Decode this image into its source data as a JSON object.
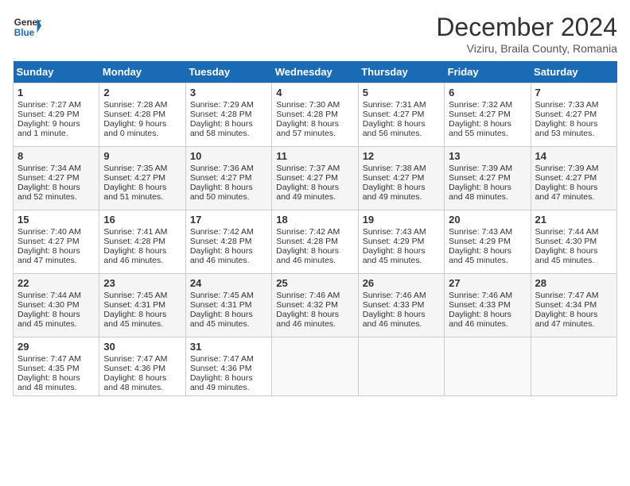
{
  "header": {
    "logo_line1": "General",
    "logo_line2": "Blue",
    "month": "December 2024",
    "location": "Viziru, Braila County, Romania"
  },
  "days_of_week": [
    "Sunday",
    "Monday",
    "Tuesday",
    "Wednesday",
    "Thursday",
    "Friday",
    "Saturday"
  ],
  "weeks": [
    [
      {
        "day": 1,
        "lines": [
          "Sunrise: 7:27 AM",
          "Sunset: 4:29 PM",
          "Daylight: 9 hours",
          "and 1 minute."
        ]
      },
      {
        "day": 2,
        "lines": [
          "Sunrise: 7:28 AM",
          "Sunset: 4:28 PM",
          "Daylight: 9 hours",
          "and 0 minutes."
        ]
      },
      {
        "day": 3,
        "lines": [
          "Sunrise: 7:29 AM",
          "Sunset: 4:28 PM",
          "Daylight: 8 hours",
          "and 58 minutes."
        ]
      },
      {
        "day": 4,
        "lines": [
          "Sunrise: 7:30 AM",
          "Sunset: 4:28 PM",
          "Daylight: 8 hours",
          "and 57 minutes."
        ]
      },
      {
        "day": 5,
        "lines": [
          "Sunrise: 7:31 AM",
          "Sunset: 4:27 PM",
          "Daylight: 8 hours",
          "and 56 minutes."
        ]
      },
      {
        "day": 6,
        "lines": [
          "Sunrise: 7:32 AM",
          "Sunset: 4:27 PM",
          "Daylight: 8 hours",
          "and 55 minutes."
        ]
      },
      {
        "day": 7,
        "lines": [
          "Sunrise: 7:33 AM",
          "Sunset: 4:27 PM",
          "Daylight: 8 hours",
          "and 53 minutes."
        ]
      }
    ],
    [
      {
        "day": 8,
        "lines": [
          "Sunrise: 7:34 AM",
          "Sunset: 4:27 PM",
          "Daylight: 8 hours",
          "and 52 minutes."
        ]
      },
      {
        "day": 9,
        "lines": [
          "Sunrise: 7:35 AM",
          "Sunset: 4:27 PM",
          "Daylight: 8 hours",
          "and 51 minutes."
        ]
      },
      {
        "day": 10,
        "lines": [
          "Sunrise: 7:36 AM",
          "Sunset: 4:27 PM",
          "Daylight: 8 hours",
          "and 50 minutes."
        ]
      },
      {
        "day": 11,
        "lines": [
          "Sunrise: 7:37 AM",
          "Sunset: 4:27 PM",
          "Daylight: 8 hours",
          "and 49 minutes."
        ]
      },
      {
        "day": 12,
        "lines": [
          "Sunrise: 7:38 AM",
          "Sunset: 4:27 PM",
          "Daylight: 8 hours",
          "and 49 minutes."
        ]
      },
      {
        "day": 13,
        "lines": [
          "Sunrise: 7:39 AM",
          "Sunset: 4:27 PM",
          "Daylight: 8 hours",
          "and 48 minutes."
        ]
      },
      {
        "day": 14,
        "lines": [
          "Sunrise: 7:39 AM",
          "Sunset: 4:27 PM",
          "Daylight: 8 hours",
          "and 47 minutes."
        ]
      }
    ],
    [
      {
        "day": 15,
        "lines": [
          "Sunrise: 7:40 AM",
          "Sunset: 4:27 PM",
          "Daylight: 8 hours",
          "and 47 minutes."
        ]
      },
      {
        "day": 16,
        "lines": [
          "Sunrise: 7:41 AM",
          "Sunset: 4:28 PM",
          "Daylight: 8 hours",
          "and 46 minutes."
        ]
      },
      {
        "day": 17,
        "lines": [
          "Sunrise: 7:42 AM",
          "Sunset: 4:28 PM",
          "Daylight: 8 hours",
          "and 46 minutes."
        ]
      },
      {
        "day": 18,
        "lines": [
          "Sunrise: 7:42 AM",
          "Sunset: 4:28 PM",
          "Daylight: 8 hours",
          "and 46 minutes."
        ]
      },
      {
        "day": 19,
        "lines": [
          "Sunrise: 7:43 AM",
          "Sunset: 4:29 PM",
          "Daylight: 8 hours",
          "and 45 minutes."
        ]
      },
      {
        "day": 20,
        "lines": [
          "Sunrise: 7:43 AM",
          "Sunset: 4:29 PM",
          "Daylight: 8 hours",
          "and 45 minutes."
        ]
      },
      {
        "day": 21,
        "lines": [
          "Sunrise: 7:44 AM",
          "Sunset: 4:30 PM",
          "Daylight: 8 hours",
          "and 45 minutes."
        ]
      }
    ],
    [
      {
        "day": 22,
        "lines": [
          "Sunrise: 7:44 AM",
          "Sunset: 4:30 PM",
          "Daylight: 8 hours",
          "and 45 minutes."
        ]
      },
      {
        "day": 23,
        "lines": [
          "Sunrise: 7:45 AM",
          "Sunset: 4:31 PM",
          "Daylight: 8 hours",
          "and 45 minutes."
        ]
      },
      {
        "day": 24,
        "lines": [
          "Sunrise: 7:45 AM",
          "Sunset: 4:31 PM",
          "Daylight: 8 hours",
          "and 45 minutes."
        ]
      },
      {
        "day": 25,
        "lines": [
          "Sunrise: 7:46 AM",
          "Sunset: 4:32 PM",
          "Daylight: 8 hours",
          "and 46 minutes."
        ]
      },
      {
        "day": 26,
        "lines": [
          "Sunrise: 7:46 AM",
          "Sunset: 4:33 PM",
          "Daylight: 8 hours",
          "and 46 minutes."
        ]
      },
      {
        "day": 27,
        "lines": [
          "Sunrise: 7:46 AM",
          "Sunset: 4:33 PM",
          "Daylight: 8 hours",
          "and 46 minutes."
        ]
      },
      {
        "day": 28,
        "lines": [
          "Sunrise: 7:47 AM",
          "Sunset: 4:34 PM",
          "Daylight: 8 hours",
          "and 47 minutes."
        ]
      }
    ],
    [
      {
        "day": 29,
        "lines": [
          "Sunrise: 7:47 AM",
          "Sunset: 4:35 PM",
          "Daylight: 8 hours",
          "and 48 minutes."
        ]
      },
      {
        "day": 30,
        "lines": [
          "Sunrise: 7:47 AM",
          "Sunset: 4:36 PM",
          "Daylight: 8 hours",
          "and 48 minutes."
        ]
      },
      {
        "day": 31,
        "lines": [
          "Sunrise: 7:47 AM",
          "Sunset: 4:36 PM",
          "Daylight: 8 hours",
          "and 49 minutes."
        ]
      },
      null,
      null,
      null,
      null
    ]
  ]
}
